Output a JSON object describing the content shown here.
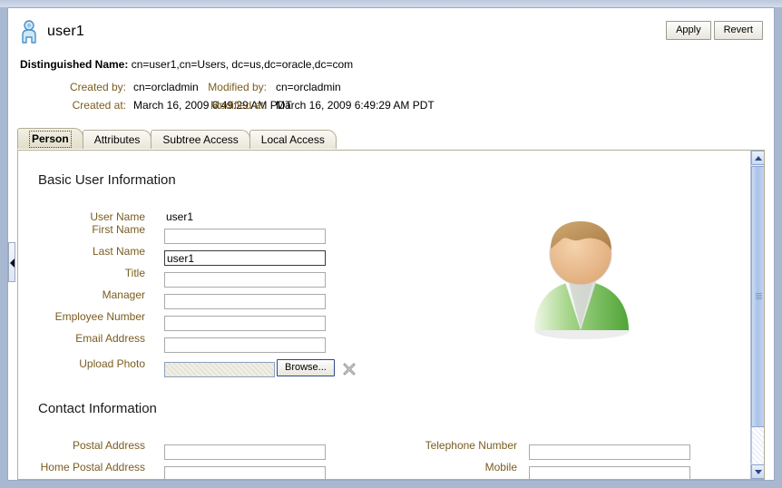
{
  "header": {
    "icon": "person-icon",
    "title": "user1",
    "dn_label": "Distinguished Name:",
    "dn_value": "cn=user1,cn=Users, dc=us,dc=oracle,dc=com",
    "meta": [
      {
        "label": "Created by:",
        "value": "cn=orcladmin"
      },
      {
        "label": "Created at:",
        "value": "March 16, 2009 6:49:29 AM PDT"
      },
      {
        "label": "Modified by:",
        "value": "cn=orcladmin"
      },
      {
        "label": "Modified at:",
        "value": "March 16, 2009 6:49:29 AM PDT"
      }
    ],
    "buttons": [
      {
        "label": "Apply",
        "name": "apply-button"
      },
      {
        "label": "Revert",
        "name": "revert-button"
      }
    ]
  },
  "tabs": [
    {
      "label": "Person",
      "active": true
    },
    {
      "label": "Attributes",
      "active": false
    },
    {
      "label": "Subtree Access",
      "active": false
    },
    {
      "label": "Local Access",
      "active": false
    }
  ],
  "sections": {
    "basic": {
      "title": "Basic User Information",
      "fields": [
        {
          "label": "User Name",
          "value": "user1",
          "type": "text-readonly"
        },
        {
          "label": "First Name",
          "value": "",
          "type": "input"
        },
        {
          "label": "Last Name",
          "value": "user1",
          "type": "input-strong"
        },
        {
          "label": "Title",
          "value": "",
          "type": "input"
        },
        {
          "label": "Manager",
          "value": "",
          "type": "input"
        },
        {
          "label": "Employee Number",
          "value": "",
          "type": "input"
        },
        {
          "label": "Email Address",
          "value": "",
          "type": "input"
        },
        {
          "label": "Upload Photo",
          "value": "",
          "type": "file"
        }
      ],
      "browse_label": "Browse...",
      "clear_icon": "clear-x-icon",
      "avatar_icon": "user-avatar-image"
    },
    "contact": {
      "title": "Contact Information",
      "left_fields": [
        {
          "label": "Postal Address",
          "value": ""
        },
        {
          "label": "Home Postal Address",
          "value": ""
        }
      ],
      "right_fields": [
        {
          "label": "Telephone Number",
          "value": ""
        },
        {
          "label": "Mobile",
          "value": ""
        }
      ]
    }
  },
  "scrollbar": {
    "up_icon": "scroll-up-arrow-icon",
    "down_icon": "scroll-down-arrow-icon",
    "thumb": "scroll-thumb"
  },
  "collapse": {
    "icon": "collapse-left-arrow-icon"
  },
  "colors": {
    "label": "#7a5c1f",
    "tab_border": "#b3ad94",
    "window_chrome": "#a8b8d0",
    "focus_border": "#2c4a86",
    "avatar_body": "#66b34d",
    "avatar_face": "#e8b887",
    "avatar_hair": "#c4975f"
  }
}
